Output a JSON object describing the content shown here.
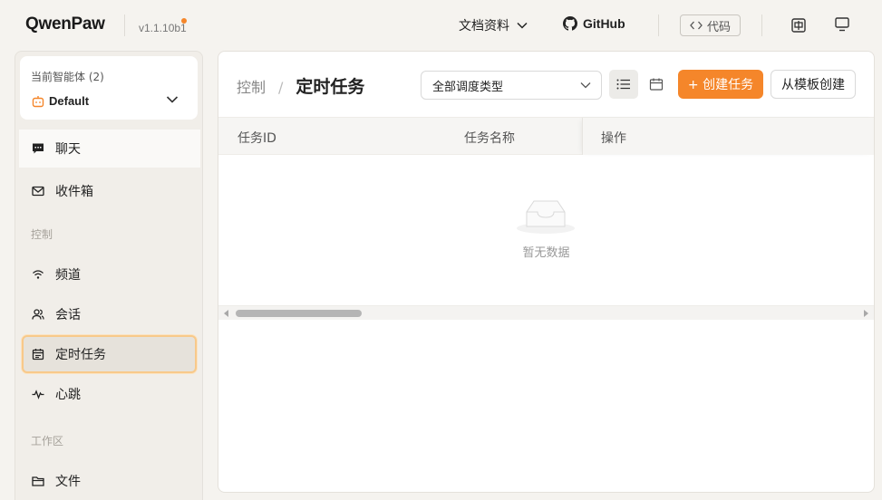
{
  "header": {
    "logo": "QwenPaw",
    "version": "v1.1.10b1",
    "docs_label": "文档资料",
    "github_label": "GitHub",
    "code_label": "代码",
    "lang_icon": "translate-icon",
    "screen_icon": "monitor-icon"
  },
  "sidebar": {
    "agent_label": "当前智能体 (2)",
    "agent_value": "Default",
    "items": [
      {
        "label": "聊天",
        "icon": "chat-icon"
      },
      {
        "label": "收件箱",
        "icon": "mail-icon"
      },
      {
        "label": "频道",
        "icon": "wifi-icon"
      },
      {
        "label": "会话",
        "icon": "users-icon"
      },
      {
        "label": "定时任务",
        "icon": "calendar-icon",
        "active": true
      },
      {
        "label": "心跳",
        "icon": "pulse-icon"
      },
      {
        "label": "文件",
        "icon": "folder-icon"
      }
    ],
    "section_control": "控制",
    "section_workspace": "工作区"
  },
  "main": {
    "breadcrumb_parent": "控制",
    "breadcrumb_sep": "/",
    "title": "定时任务",
    "filter_value": "全部调度类型",
    "create_button": "+ 创建任务",
    "template_button": "从模板创建",
    "table": {
      "columns": [
        "任务ID",
        "任务名称",
        "操作"
      ],
      "rows": [],
      "empty_text": "暂无数据"
    }
  },
  "colors": {
    "accent": "#f5862a",
    "active_border": "#f8c98a",
    "background": "#f5f3ef"
  }
}
